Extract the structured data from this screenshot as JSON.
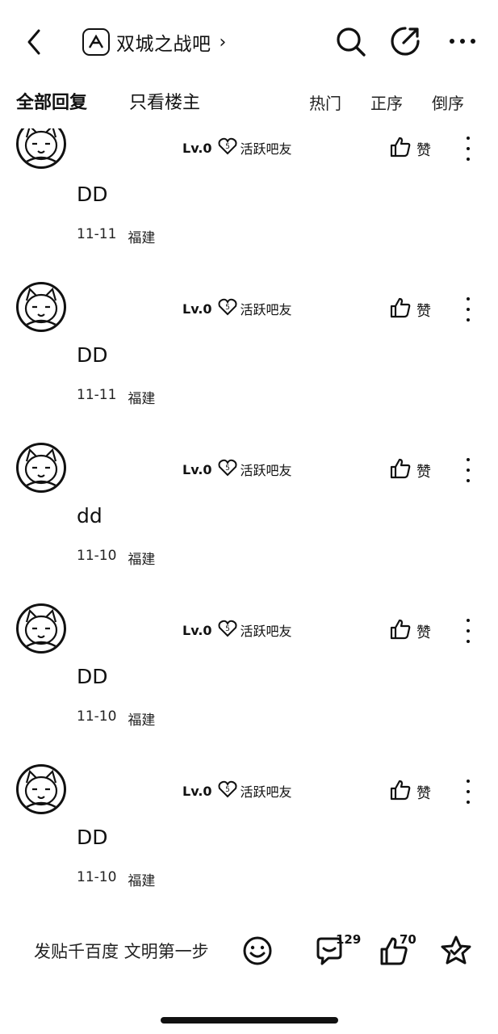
{
  "header": {
    "forum_name": "双城之战吧",
    "chevron": "›"
  },
  "tabs": {
    "all_replies": "全部回复",
    "only_op": "只看楼主",
    "hot": "热门",
    "ascending": "正序",
    "descending": "倒序"
  },
  "posts": [
    {
      "level": "Lv.0",
      "badge": "活跃吧友",
      "like_label": "赞",
      "content": "DD",
      "date": "11-11",
      "location": "福建"
    },
    {
      "level": "Lv.0",
      "badge": "活跃吧友",
      "like_label": "赞",
      "content": "DD",
      "date": "11-11",
      "location": "福建"
    },
    {
      "level": "Lv.0",
      "badge": "活跃吧友",
      "like_label": "赞",
      "content": "dd",
      "date": "11-10",
      "location": "福建"
    },
    {
      "level": "Lv.0",
      "badge": "活跃吧友",
      "like_label": "赞",
      "content": "DD",
      "date": "11-10",
      "location": "福建"
    },
    {
      "level": "Lv.0",
      "badge": "活跃吧友",
      "like_label": "赞",
      "content": "DD",
      "date": "11-10",
      "location": "福建"
    }
  ],
  "bottom": {
    "input_placeholder": "发贴千百度 文明第一步",
    "comment_count": "129",
    "like_count": "70"
  }
}
